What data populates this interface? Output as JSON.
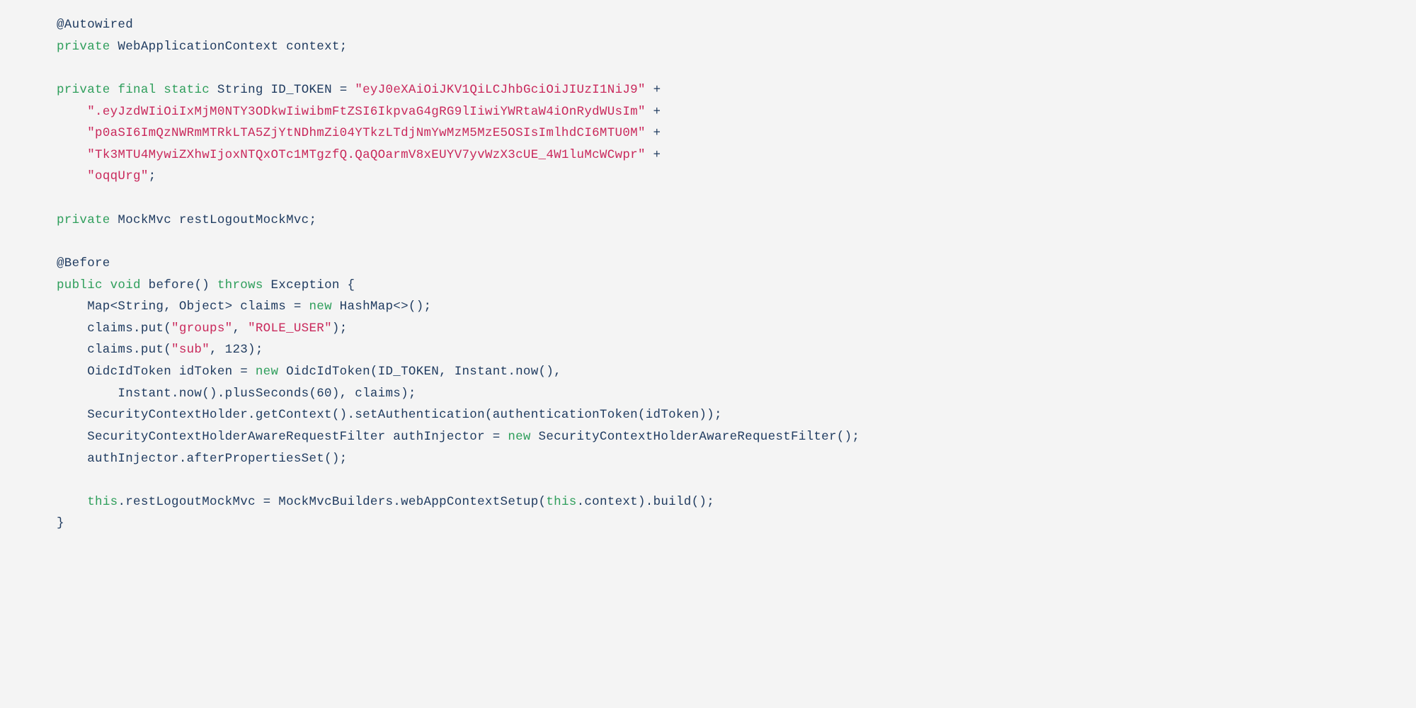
{
  "code": {
    "l01": {
      "a": "@Autowired"
    },
    "l02": {
      "a": "private",
      "b": " WebApplicationContext context;"
    },
    "l03": {
      "a": ""
    },
    "l04": {
      "a": "private",
      "b": " ",
      "c": "final",
      "d": " ",
      "e": "static",
      "f": " String ID_TOKEN = ",
      "g": "\"eyJ0eXAiOiJKV1QiLCJhbGciOiJIUzI1NiJ9\"",
      "h": " +"
    },
    "l05": {
      "a": "    ",
      "b": "\".eyJzdWIiOiIxMjM0NTY3ODkwIiwibmFtZSI6IkpvaG4gRG9lIiwiYWRtaW4iOnRydWUsIm\"",
      "c": " +"
    },
    "l06": {
      "a": "    ",
      "b": "\"p0aSI6ImQzNWRmMTRkLTA5ZjYtNDhmZi04YTkzLTdjNmYwMzM5MzE5OSIsImlhdCI6MTU0M\"",
      "c": " +"
    },
    "l07": {
      "a": "    ",
      "b": "\"Tk3MTU4MywiZXhwIjoxNTQxOTc1MTgzfQ.QaQOarmV8xEUYV7yvWzX3cUE_4W1luMcWCwpr\"",
      "c": " +"
    },
    "l08": {
      "a": "    ",
      "b": "\"oqqUrg\"",
      "c": ";"
    },
    "l09": {
      "a": ""
    },
    "l10": {
      "a": "private",
      "b": " MockMvc restLogoutMockMvc;"
    },
    "l11": {
      "a": ""
    },
    "l12": {
      "a": "@Before"
    },
    "l13": {
      "a": "public",
      "b": " ",
      "c": "void",
      "d": " before() ",
      "e": "throws",
      "f": " Exception {"
    },
    "l14": {
      "a": "    Map<String, Object> claims = ",
      "b": "new",
      "c": " HashMap<>();"
    },
    "l15": {
      "a": "    claims.put(",
      "b": "\"groups\"",
      "c": ", ",
      "d": "\"ROLE_USER\"",
      "e": ");"
    },
    "l16": {
      "a": "    claims.put(",
      "b": "\"sub\"",
      "c": ", 123);"
    },
    "l17": {
      "a": "    OidcIdToken idToken = ",
      "b": "new",
      "c": " OidcIdToken(ID_TOKEN, Instant.now(),"
    },
    "l18": {
      "a": "        Instant.now().plusSeconds(60), claims);"
    },
    "l19": {
      "a": "    SecurityContextHolder.getContext().setAuthentication(authenticationToken(idToken));"
    },
    "l20": {
      "a": "    SecurityContextHolderAwareRequestFilter authInjector = ",
      "b": "new",
      "c": " SecurityContextHolderAwareRequestFilter();"
    },
    "l21": {
      "a": "    authInjector.afterPropertiesSet();"
    },
    "l22": {
      "a": ""
    },
    "l23": {
      "a": "    ",
      "b": "this",
      "c": ".restLogoutMockMvc = MockMvcBuilders.webAppContextSetup(",
      "d": "this",
      "e": ".context).build();"
    },
    "l24": {
      "a": "}"
    }
  }
}
